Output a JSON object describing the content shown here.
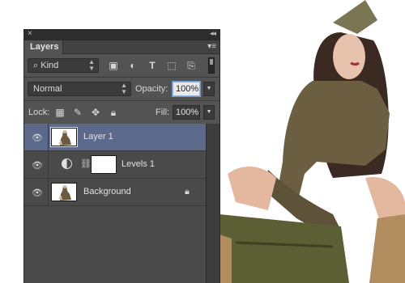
{
  "panel": {
    "close_glyph": "×",
    "collapse_glyph": "◂◂",
    "tab_label": "Layers",
    "menu_glyph": "▾≡"
  },
  "filter": {
    "kind_label": "Kind",
    "search_glyph": "⌕",
    "buttons": [
      {
        "name": "filter-pixel-icon",
        "glyph": "▣"
      },
      {
        "name": "filter-adjustment-icon",
        "glyph": "◐"
      },
      {
        "name": "filter-type-icon",
        "glyph": "T"
      },
      {
        "name": "filter-shape-icon",
        "glyph": "⬚"
      },
      {
        "name": "filter-smartobject-icon",
        "glyph": "⎘"
      }
    ]
  },
  "blend": {
    "mode": "Normal",
    "opacity_label": "Opacity:",
    "opacity_value": "100%"
  },
  "lock": {
    "label": "Lock:",
    "icons": [
      {
        "name": "lock-transparent-icon",
        "glyph": "▦"
      },
      {
        "name": "lock-pixels-icon",
        "glyph": "✎"
      },
      {
        "name": "lock-position-icon",
        "glyph": "✥"
      },
      {
        "name": "lock-all-icon",
        "glyph": "🔒︎"
      }
    ],
    "fill_label": "Fill:",
    "fill_value": "100%"
  },
  "layers": [
    {
      "name": "Layer 1",
      "selected": true,
      "type": "pixel"
    },
    {
      "name": "Levels 1",
      "selected": false,
      "type": "adjustment"
    },
    {
      "name": "Background",
      "selected": false,
      "type": "background",
      "locked": true
    }
  ],
  "icons": {
    "eye": "👁︎",
    "chain": "⛓︎",
    "lock": "🔒︎",
    "dropdown": "▲▼",
    "arrow": "▼"
  },
  "colors": {
    "panel_bg": "#535353",
    "selected_row": "#5b6a8a",
    "titlebar": "#2d2d2d"
  }
}
